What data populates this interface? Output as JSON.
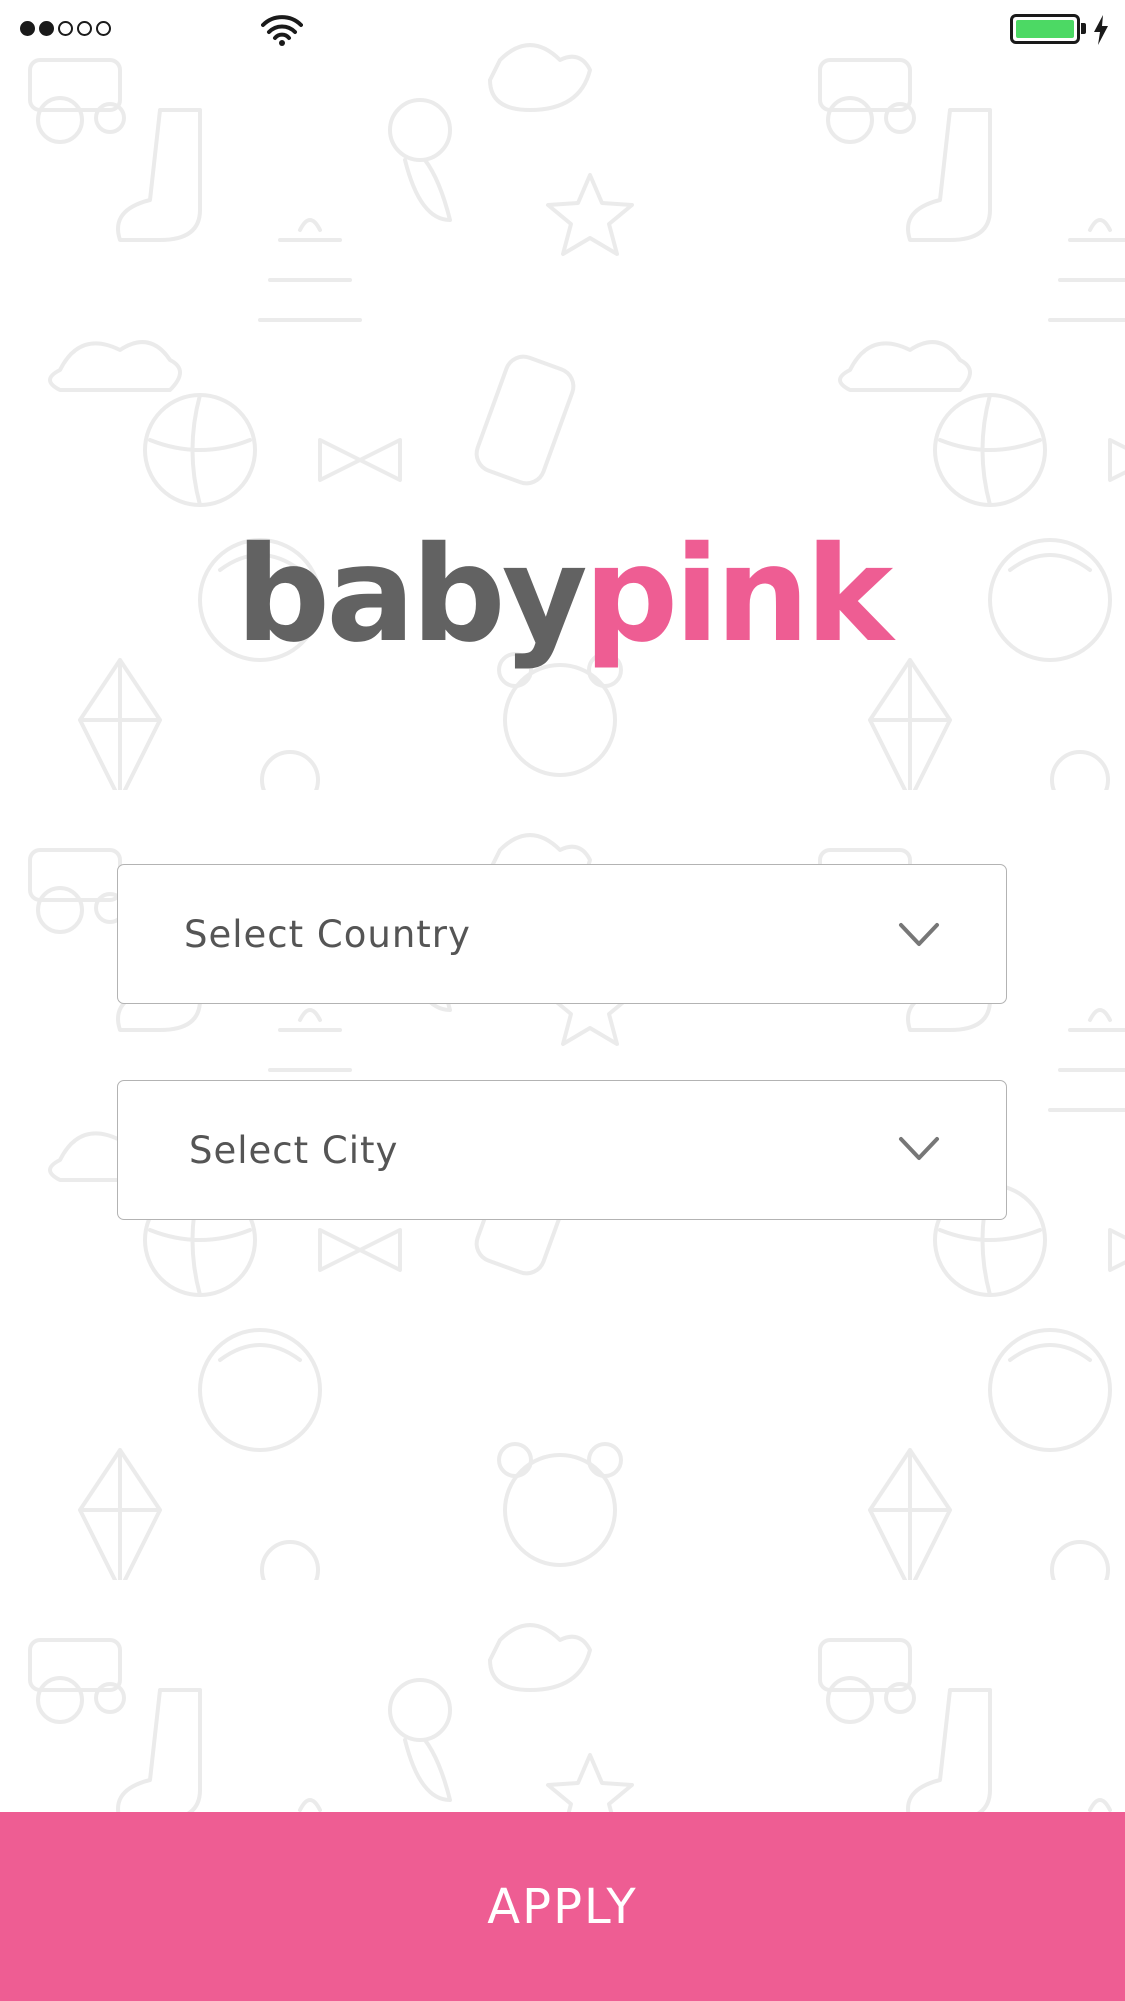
{
  "status_bar": {
    "signal_bars": [
      true,
      true,
      false,
      false,
      false
    ],
    "wifi_icon": "wifi-icon",
    "battery_icon": "battery-icon",
    "charging_icon": "bolt-icon",
    "battery_color": "#4cd964"
  },
  "logo": {
    "part1": "baby",
    "part2": "pink",
    "part1_color": "#626262",
    "part2_color": "#ee5d93"
  },
  "form": {
    "country_placeholder": "Select Country",
    "city_placeholder": "Select City",
    "dropdown_icon": "chevron-down-icon"
  },
  "apply_button": {
    "label": "APPLY",
    "color": "#ee5d93"
  },
  "background": {
    "pattern": "baby-toys-doodle-pattern"
  }
}
